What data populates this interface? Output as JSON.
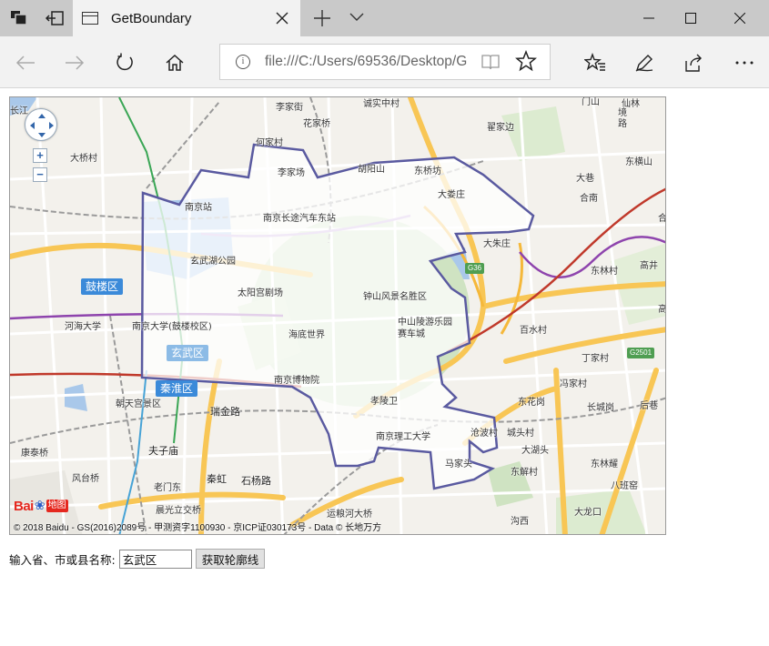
{
  "browser": {
    "tab_title": "GetBoundary",
    "url": "file:///C:/Users/69536/Desktop/G",
    "icons": [
      "tab-manager-icon",
      "back-tab-icon",
      "page-icon",
      "close-icon",
      "plus-icon",
      "chevron-down-icon",
      "minimize-icon",
      "maximize-icon",
      "close-window-icon",
      "back-arrow-icon",
      "forward-arrow-icon",
      "refresh-icon",
      "home-icon",
      "info-icon",
      "reader-view-icon",
      "star-icon",
      "favorites-icon",
      "pen-icon",
      "share-icon",
      "more-icon"
    ]
  },
  "map": {
    "controls": {
      "zoom_in": "+",
      "zoom_out": "−"
    },
    "districts": {
      "gulou": "鼓楼区",
      "xuanwu": "玄武区",
      "qinhuai": "秦淮区"
    },
    "labels": {
      "l1": "长江",
      "l2": "大桥村",
      "l3": "李家街",
      "l4": "花家桥",
      "l5": "诚实中村",
      "l6": "何家村",
      "l7": "李家场",
      "l8": "胡阳山",
      "l9": "东桥坊",
      "l10": "翟家边",
      "l11": "南京站",
      "l12": "南京长途汽车东站",
      "l13": "大娄庄",
      "l14": "玄武湖公园",
      "l15": "太阳宫剧场",
      "l16": "钟山风景名胜区",
      "l17": "河海大学",
      "l18": "南京大学(鼓楼校区)",
      "l19": "海底世界",
      "l20": "中山陵游乐园",
      "l21": "赛车城",
      "l22": "南京博物院",
      "l23": "朝天宫景区",
      "l24": "孝陵卫",
      "l25": "瑞金路",
      "l26": "南京理工大学",
      "l27": "康泰桥",
      "l28": "夫子庙",
      "l29": "风台桥",
      "l30": "老门东",
      "l31": "秦虹",
      "l32": "石杨路",
      "l33": "晨光立交桥",
      "l34": "运粮河大桥",
      "l35": "大朱庄",
      "l36": "百水村",
      "l37": "东林村",
      "l38": "高井",
      "l39": "大巷",
      "l40": "合南",
      "l41": "东横山",
      "l42": "丁家村",
      "l43": "冯家村",
      "l44": "长城岗",
      "l45": "后巷",
      "l46": "东花岗",
      "l47": "城头村",
      "l48": "大湖头",
      "l49": "东解村",
      "l50": "东林耀",
      "l51": "八班窑",
      "l52": "大龙口",
      "l53": "沟西",
      "l54": "马家头",
      "l55": "沧波村",
      "l56": "仙林",
      "l57": "境",
      "l58": "路",
      "l59": "门山",
      "l60": "合",
      "l61": "高"
    },
    "shields": {
      "g36": "G36",
      "g2501": "G2501"
    },
    "logo_text": "Bai 地图",
    "copyright": "© 2018 Baidu - GS(2016)2089号 - 甲测资字1100930 - 京ICP证030173号 - Data © 长地万方"
  },
  "form": {
    "label": "输入省、市或县名称:",
    "input_value": "玄武区",
    "button_label": "获取轮廓线"
  }
}
